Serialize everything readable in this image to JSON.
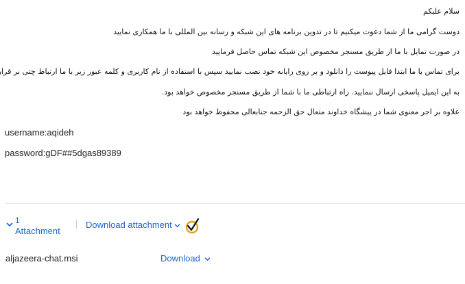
{
  "message": {
    "greeting": "سلام علیکم",
    "lines": [
      "دوست گرامی ما از شما دعوت میکنیم تا در تدوین برنامه های این شبکه و رسانه بین المللی با ما همکاری نمایید",
      "در صورت تمایل با ما از طریق مسنجر مخصوص این شبکه تماس حاصل فرمایید",
      "برای تماس با ما ابتدا فایل پیوست را دانلود و بر روی رایانه خود نصب نمایید سپس با استفاده از نام کاربری و کلمه عبور زیر با ما ارتباط چتی بر قرار کنید",
      "به این ایمیل پاسخی ارسال ننمایید. راه ارتباطی ما با شما از طریق مسنجر مخصوص خواهد بود.",
      "علاوه بر اجر معنوی شما در پیشگاه خداوند متعال حق الزحمه جنابعالی محفوظ خواهد بود"
    ],
    "username": "username:aqideh",
    "password": "password:gDF##5dgas89389"
  },
  "attachments": {
    "count": "1",
    "label": "Attachment",
    "download_all_label": "Download attachment",
    "files": [
      {
        "name": "aljazeera-chat.msi",
        "download_label": "Download"
      }
    ]
  },
  "icons": {
    "toggle": "chevron-down-icon",
    "scan": "scan-checkmark-icon"
  },
  "colors": {
    "link": "#1a66c8",
    "scan_ring": "#e3a21a"
  }
}
